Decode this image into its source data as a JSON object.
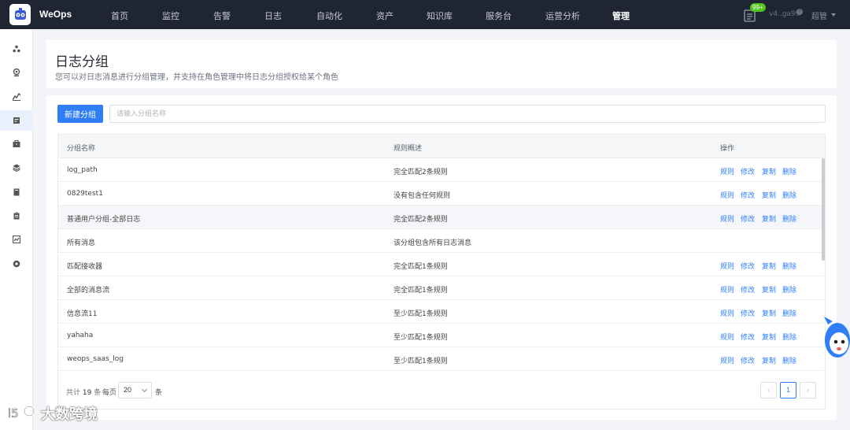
{
  "app": {
    "brand": "WeOps",
    "nav": [
      "首页",
      "监控",
      "告警",
      "日志",
      "自动化",
      "资产",
      "知识库",
      "服务台",
      "运营分析",
      "管理"
    ],
    "active_nav": "管理",
    "notify_badge": "99+",
    "user": "v4..ga99",
    "role": "超管",
    "accent_color": "#2f7ef5",
    "topbar_color": "#1f2533"
  },
  "sidebar": {
    "icons": [
      "cluster-icon",
      "monitor-icon",
      "alarm-icon",
      "log-icon",
      "box-icon",
      "layers-icon",
      "book-icon",
      "clipboard-icon",
      "chart-icon",
      "gear-icon"
    ],
    "active_index": 3
  },
  "header": {
    "title": "日志分组",
    "description": "您可以对日志消息进行分组管理，并支持在角色管理中将日志分组授权给某个角色"
  },
  "toolbar": {
    "new_button": "新建分组",
    "search_placeholder": "请输入分组名称"
  },
  "table": {
    "columns": [
      "分组名称",
      "规则概述",
      "操作"
    ],
    "actions": [
      "规则",
      "修改",
      "复制",
      "删除"
    ],
    "rows": [
      {
        "name": "log_path",
        "summary": "完全匹配2条规则",
        "actions": true
      },
      {
        "name": "0829test1",
        "summary": "没有包含任何规则",
        "actions": true
      },
      {
        "name": "普通用户分组-全部日志",
        "summary": "完全匹配2条规则",
        "actions": true
      },
      {
        "name": "所有消息",
        "summary": "该分组包含所有日志消息",
        "actions": false
      },
      {
        "name": "匹配接收器",
        "summary": "完全匹配1条规则",
        "actions": true
      },
      {
        "name": "全部的消息流",
        "summary": "完全匹配1条规则",
        "actions": true
      },
      {
        "name": "信息流11",
        "summary": "至少匹配1条规则",
        "actions": true
      },
      {
        "name": "yahaha",
        "summary": "至少匹配1条规则",
        "actions": true
      },
      {
        "name": "weops_saas_log",
        "summary": "至少匹配1条规则",
        "actions": true
      }
    ]
  },
  "pagination": {
    "total_prefix": "共计",
    "total": "19",
    "total_suffix": "条",
    "per_page_label": "每页",
    "page_size": "20",
    "unit": "条",
    "current_page": "1"
  },
  "watermark": {
    "text": "大数跨境"
  }
}
